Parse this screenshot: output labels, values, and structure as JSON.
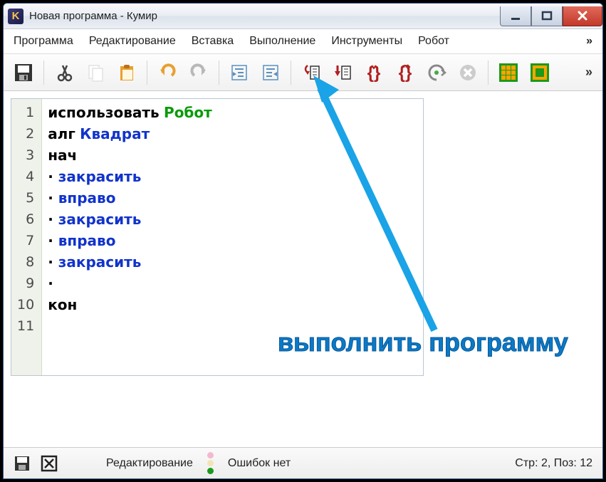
{
  "window": {
    "title": "Новая программа - Кумир",
    "app_icon_letter": "K"
  },
  "menu": {
    "items": [
      "Программа",
      "Редактирование",
      "Вставка",
      "Выполнение",
      "Инструменты",
      "Робот"
    ],
    "overflow": "»"
  },
  "toolbar": {
    "overflow": "»"
  },
  "code": {
    "lines": [
      {
        "n": 1,
        "tokens": [
          {
            "t": "использовать",
            "c": "kw-black"
          },
          {
            "t": " "
          },
          {
            "t": "Робот",
            "c": "kw-green"
          }
        ]
      },
      {
        "n": 2,
        "tokens": [
          {
            "t": "алг",
            "c": "kw-black"
          },
          {
            "t": " "
          },
          {
            "t": "Квадрат",
            "c": "kw-blue"
          }
        ]
      },
      {
        "n": 3,
        "tokens": [
          {
            "t": "нач",
            "c": "kw-black"
          }
        ]
      },
      {
        "n": 4,
        "tokens": [
          {
            "t": "· ",
            "c": "dot"
          },
          {
            "t": "закрасить",
            "c": "cmd"
          }
        ]
      },
      {
        "n": 5,
        "tokens": [
          {
            "t": "· ",
            "c": "dot"
          },
          {
            "t": "вправо",
            "c": "cmd"
          }
        ]
      },
      {
        "n": 6,
        "tokens": [
          {
            "t": "· ",
            "c": "dot"
          },
          {
            "t": "закрасить",
            "c": "cmd"
          }
        ]
      },
      {
        "n": 7,
        "tokens": [
          {
            "t": "· ",
            "c": "dot"
          },
          {
            "t": "вправо",
            "c": "cmd"
          }
        ]
      },
      {
        "n": 8,
        "tokens": [
          {
            "t": "· ",
            "c": "dot"
          },
          {
            "t": "закрасить",
            "c": "cmd"
          }
        ]
      },
      {
        "n": 9,
        "tokens": [
          {
            "t": "·",
            "c": "dot"
          }
        ]
      },
      {
        "n": 10,
        "tokens": [
          {
            "t": "кон",
            "c": "kw-black"
          }
        ]
      },
      {
        "n": 11,
        "tokens": [
          {
            "t": ""
          }
        ]
      }
    ]
  },
  "status": {
    "mode": "Редактирование",
    "errors": "Ошибок нет",
    "cursor": "Стр: 2, Поз: 12"
  },
  "annotation": {
    "text": "выполнить программу"
  }
}
